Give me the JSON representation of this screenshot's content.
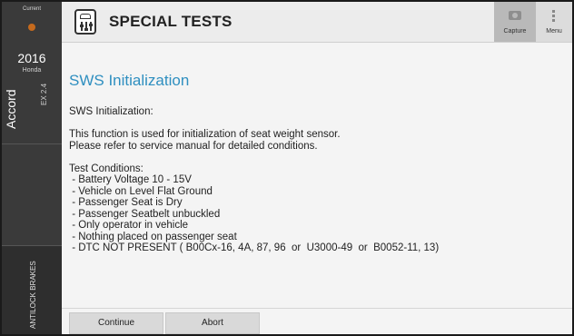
{
  "sidebar": {
    "current_label": "Current",
    "year": "2016",
    "make": "Honda",
    "model": "Accord",
    "trim": "EX 2.4",
    "system": "ANTILOCK BRAKES",
    "status_dot_color": "#c56a1d"
  },
  "header": {
    "title": "SPECIAL TESTS",
    "icon": "special-tests-icon",
    "capture_label": "Capture",
    "menu_label": "Menu"
  },
  "content": {
    "title": "SWS Initialization",
    "intro": "SWS Initialization:",
    "description": [
      "This function is used for initialization of seat weight sensor.",
      "Please refer to service manual for detailed conditions."
    ],
    "conditions_heading": "Test Conditions:",
    "conditions": [
      " - Battery Voltage 10 - 15V",
      " - Vehicle on Level Flat Ground",
      " - Passenger Seat is Dry",
      " - Passenger Seatbelt unbuckled",
      " - Only operator in vehicle",
      " - Nothing placed on passenger seat",
      " - DTC NOT PRESENT ( B00Cx-16, 4A, 87, 96  or  U3000-49  or  B0052-11, 13)"
    ]
  },
  "footer": {
    "continue_label": "Continue",
    "abort_label": "Abort"
  },
  "colors": {
    "accent": "#2f8fc0",
    "sidebar": "#3a3a3a"
  }
}
